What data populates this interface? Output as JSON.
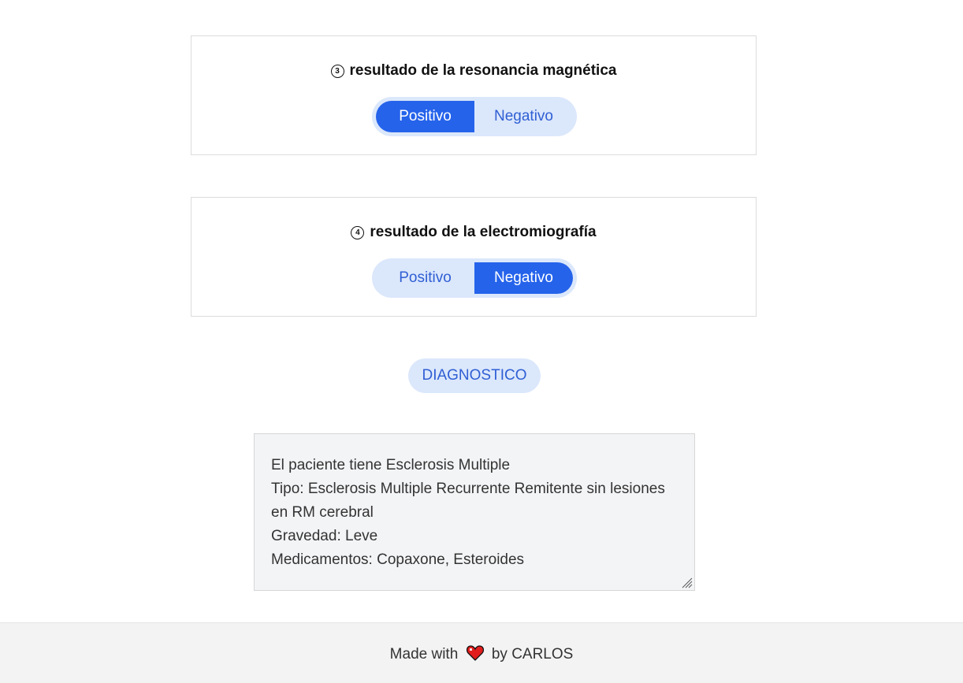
{
  "questions": [
    {
      "number": "3",
      "title": "resultado de la resonancia magnética",
      "options": {
        "positive": "Positivo",
        "negative": "Negativo"
      },
      "selected": "positive"
    },
    {
      "number": "4",
      "title": "resultado de la electromiografía",
      "options": {
        "positive": "Positivo",
        "negative": "Negativo"
      },
      "selected": "negative"
    }
  ],
  "diagnose_button": {
    "label": "DIAGNOSTICO"
  },
  "result": {
    "lines": [
      "El paciente tiene Esclerosis Multiple",
      "Tipo: Esclerosis Multiple Recurrente Remitente sin lesiones",
      "en RM cerebral",
      "Gravedad: Leve",
      "Medicamentos: Copaxone, Esteroides"
    ]
  },
  "footer": {
    "prefix": "Made with",
    "suffix": "by CARLOS",
    "icon": "heart-icon"
  },
  "colors": {
    "accent": "#2563eb",
    "accent_light": "#dbe7fb",
    "heart": "#e11d1d"
  }
}
